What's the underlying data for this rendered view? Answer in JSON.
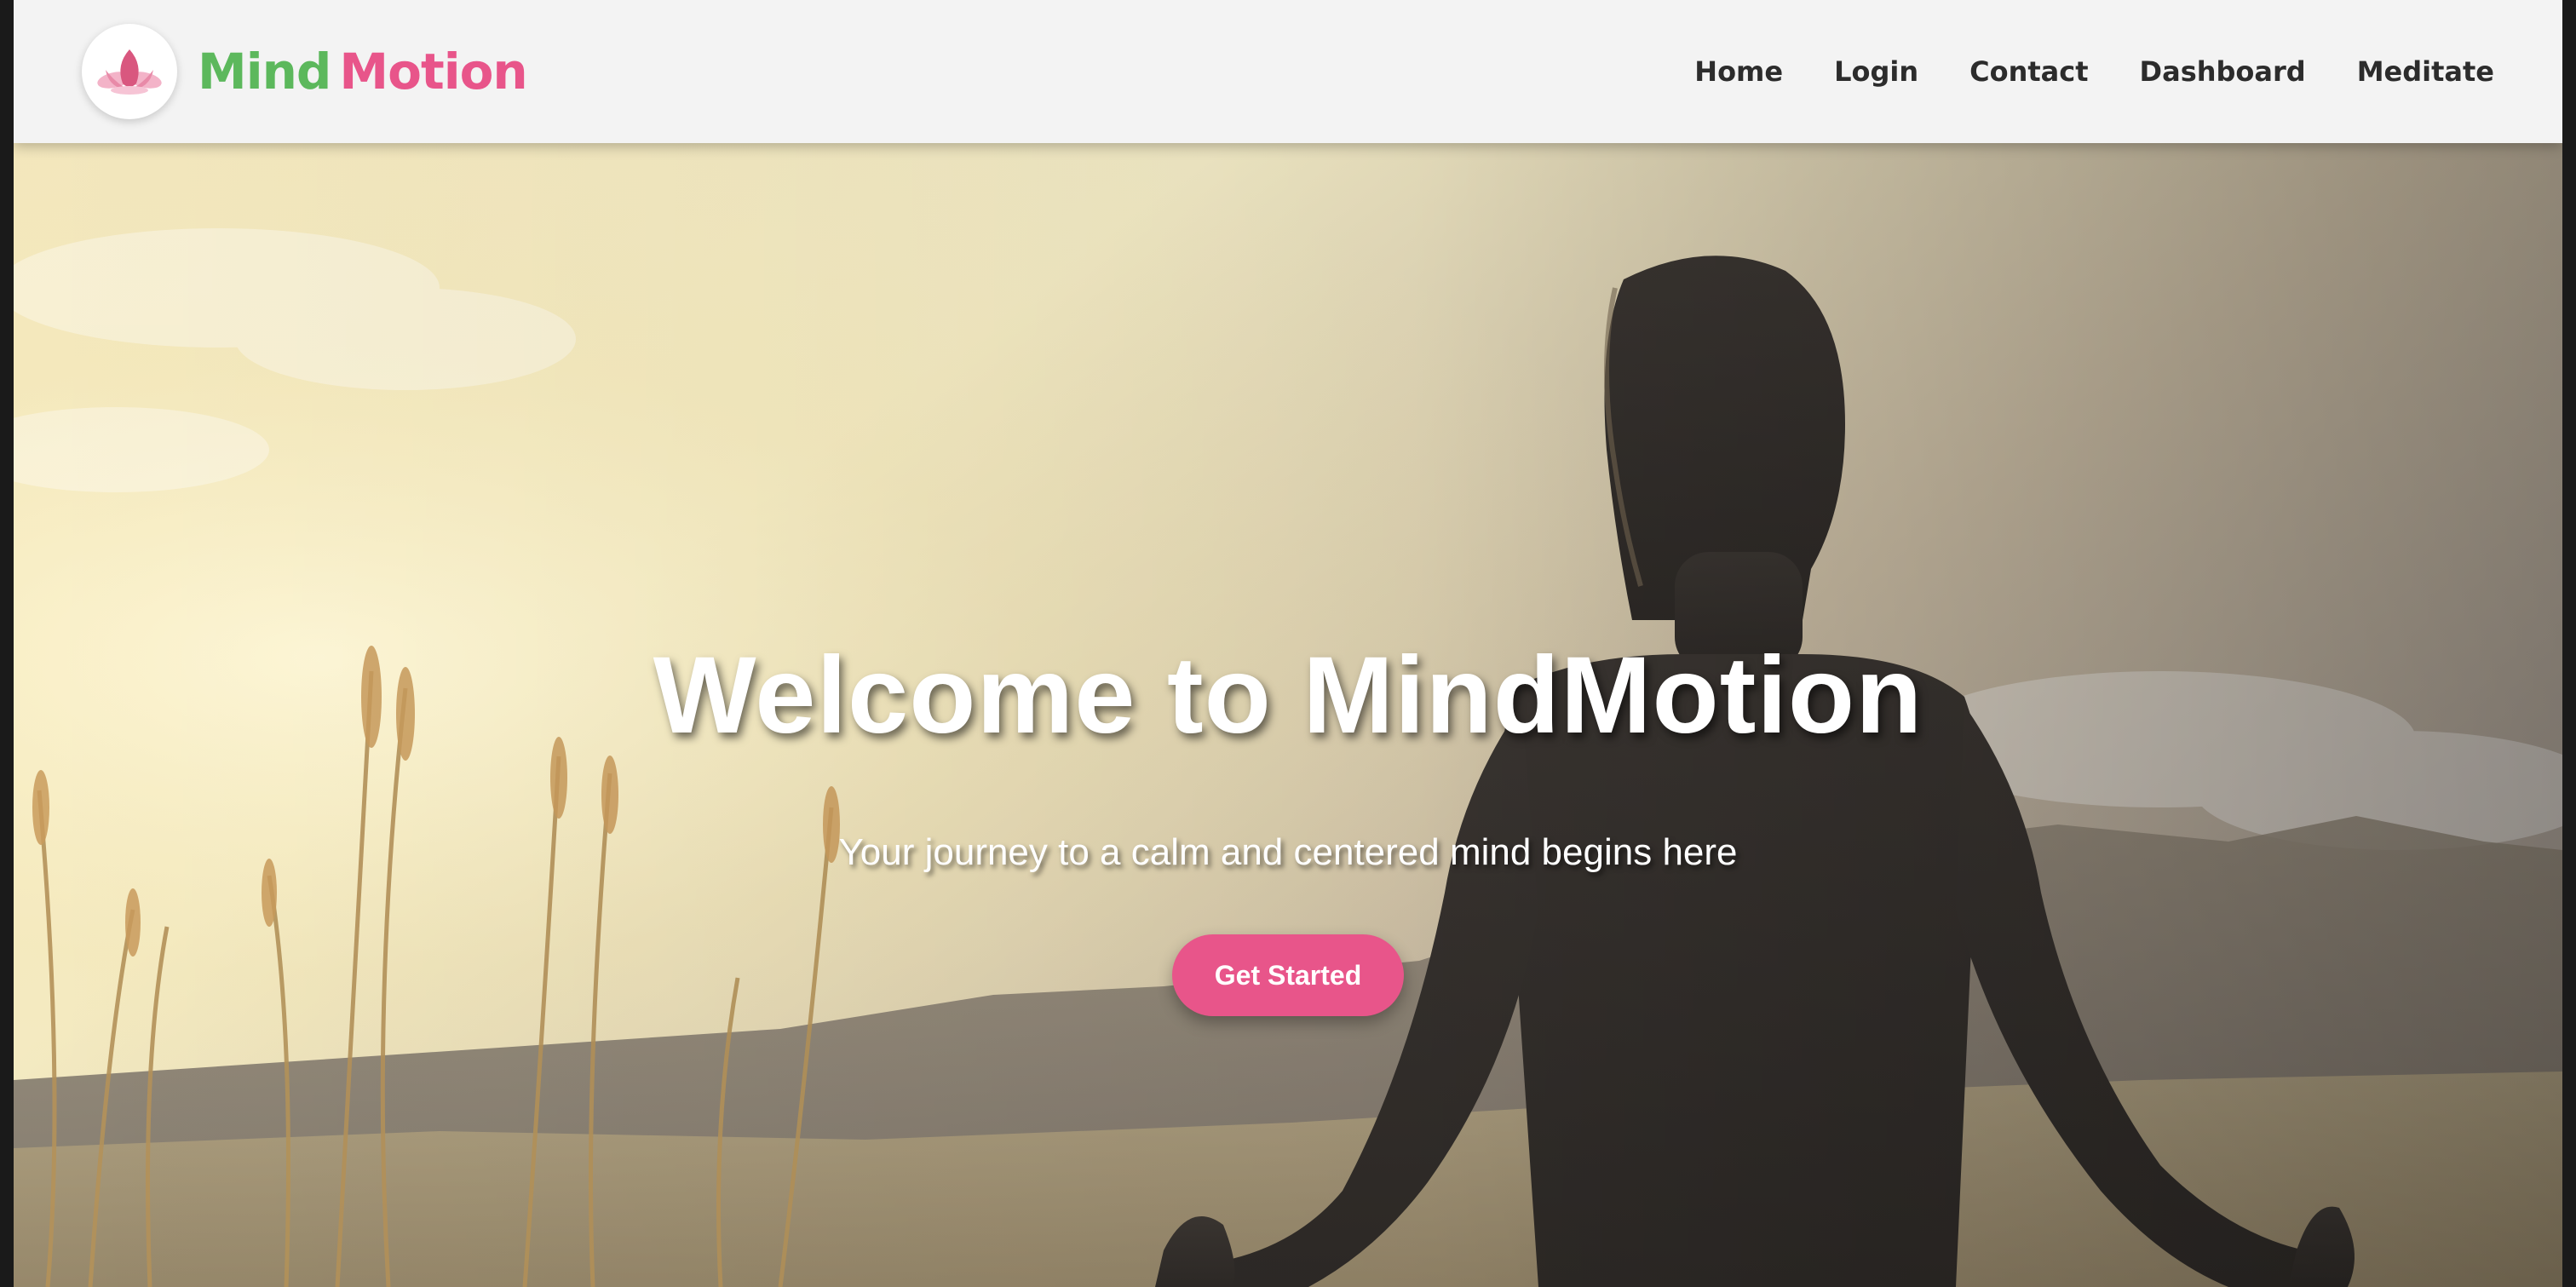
{
  "brand": {
    "name_part1": "Mind",
    "name_part2": "Motion",
    "logo_icon": "lotus-icon",
    "color_part1": "#5cb85c",
    "color_part2": "#e8558a"
  },
  "nav": {
    "items": [
      {
        "label": "Home"
      },
      {
        "label": "Login"
      },
      {
        "label": "Contact"
      },
      {
        "label": "Dashboard"
      },
      {
        "label": "Meditate"
      }
    ]
  },
  "hero": {
    "title": "Welcome to MindMotion",
    "subtitle": "Your journey to a calm and centered mind begins here",
    "cta_label": "Get Started",
    "cta_color": "#e8558a",
    "background_image": "silhouette of a woman meditating at sunset with grass and mountains"
  }
}
